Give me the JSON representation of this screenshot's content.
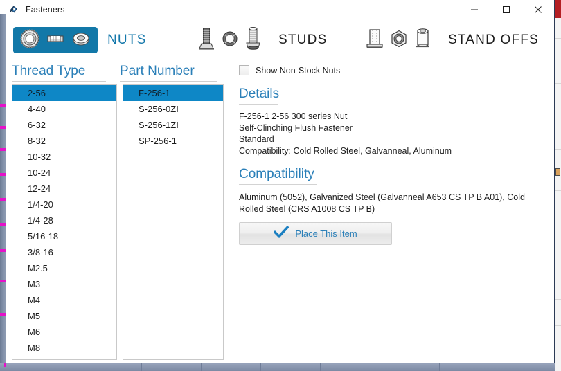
{
  "window": {
    "title": "Fasteners",
    "icon": "fastener-app-icon",
    "caption_buttons": [
      {
        "name": "minimize",
        "glyph": "–"
      },
      {
        "name": "maximize",
        "glyph": "☐"
      },
      {
        "name": "close",
        "glyph": "✕"
      }
    ]
  },
  "colors": {
    "accent_blue": "#2a7fb8",
    "selection_blue": "#0e87c6",
    "tab_blue": "#1278a8",
    "text": "#1c1c1c",
    "border": "#c9c9c9"
  },
  "categories": [
    {
      "label": "NUTS",
      "selected": true,
      "icons": [
        "knurled-nut-icon",
        "hex-barrel-nut-icon",
        "flush-nut-icon"
      ]
    },
    {
      "label": "STUDS",
      "selected": false,
      "icons": [
        "ribbed-stud-icon",
        "washer-ring-icon",
        "threaded-stud-icon"
      ]
    },
    {
      "label": "STAND OFFS",
      "selected": false,
      "icons": [
        "square-standoff-icon",
        "hex-standoff-icon",
        "round-standoff-icon"
      ]
    }
  ],
  "thread_type": {
    "header": "Thread Type",
    "selected_index": 0,
    "items": [
      "2-56",
      "4-40",
      "6-32",
      "8-32",
      "10-32",
      "10-24",
      "12-24",
      "1/4-20",
      "1/4-28",
      "5/16-18",
      "3/8-16",
      "M2.5",
      "M3",
      "M4",
      "M5",
      "M6",
      "M8"
    ]
  },
  "part_number": {
    "header": "Part Number",
    "selected_index": 0,
    "items": [
      "F-256-1",
      "S-256-0ZI",
      "S-256-1ZI",
      "SP-256-1"
    ]
  },
  "options": {
    "show_non_stock": {
      "label": "Show Non-Stock Nuts",
      "checked": false
    }
  },
  "details": {
    "header": "Details",
    "lines": [
      "F-256-1 2-56 300 series Nut",
      "Self-Clinching Flush Fastener",
      "Standard",
      "Compatibility: Cold Rolled Steel, Galvanneal, Aluminum"
    ]
  },
  "compatibility": {
    "header": "Compatibility",
    "text": "Aluminum (5052), Galvanized Steel (Galvanneal A653 CS TP B A01), Cold Rolled Steel (CRS A1008 CS TP B)"
  },
  "place_button": {
    "label": "Place This Item",
    "icon": "check-icon"
  }
}
